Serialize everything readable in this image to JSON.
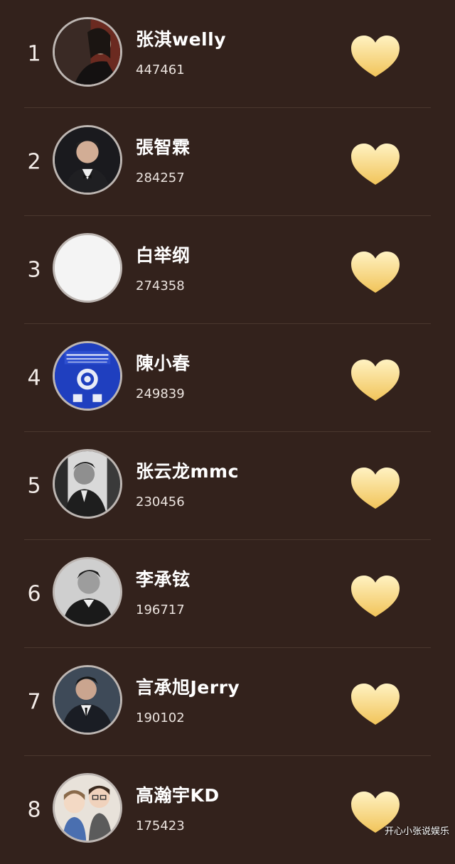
{
  "colors": {
    "background": "#33221c",
    "heart_top": "#fff2c2",
    "heart_bottom": "#f1c45a",
    "avatar_border": "#bdb6b2"
  },
  "list": {
    "items": [
      {
        "rank": "1",
        "name": "张淇welly",
        "score": "447461",
        "avatar_icon": "avatar-photo-icon",
        "like_icon": "heart-icon"
      },
      {
        "rank": "2",
        "name": "張智霖",
        "score": "284257",
        "avatar_icon": "avatar-photo-icon",
        "like_icon": "heart-icon"
      },
      {
        "rank": "3",
        "name": "白举纲",
        "score": "274358",
        "avatar_icon": "avatar-blank-icon",
        "like_icon": "heart-icon"
      },
      {
        "rank": "4",
        "name": "陳小春",
        "score": "249839",
        "avatar_icon": "passport-emblem-icon",
        "like_icon": "heart-icon"
      },
      {
        "rank": "5",
        "name": "张云龙mmc",
        "score": "230456",
        "avatar_icon": "avatar-photo-icon",
        "like_icon": "heart-icon"
      },
      {
        "rank": "6",
        "name": "李承铉",
        "score": "196717",
        "avatar_icon": "avatar-photo-icon",
        "like_icon": "heart-icon"
      },
      {
        "rank": "7",
        "name": "言承旭Jerry",
        "score": "190102",
        "avatar_icon": "avatar-photo-icon",
        "like_icon": "heart-icon"
      },
      {
        "rank": "8",
        "name": "高瀚宇KD",
        "score": "175423",
        "avatar_icon": "avatar-cartoon-icon",
        "like_icon": "heart-icon"
      }
    ]
  },
  "watermark": {
    "text": "开心小张说娱乐"
  }
}
